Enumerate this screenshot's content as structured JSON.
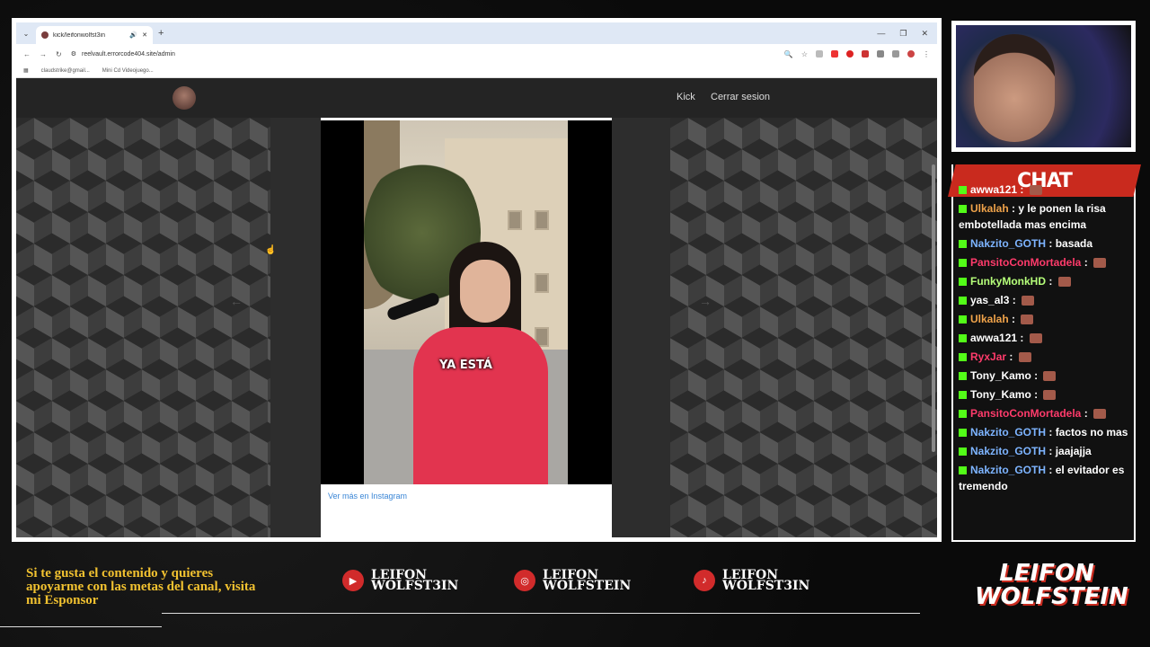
{
  "browser": {
    "tab_title": "kick/leifonwolfst3in",
    "url": "reelvault.errorcode404.site/admin",
    "bookmarks": [
      "claudstrike@gmail...",
      "Mini Cd Videojuego..."
    ]
  },
  "site": {
    "nav_kick": "Kick",
    "nav_logout": "Cerrar sesion",
    "video_caption": "YA ESTÁ",
    "instagram_link": "Ver más en Instagram"
  },
  "chat": {
    "title": "CHAT",
    "messages": [
      {
        "user": "awwa121",
        "text": "",
        "color": "#ffffff"
      },
      {
        "user": "Ulkalah",
        "text": "y le ponen la risa embotellada mas encima",
        "color": "#f0a34a"
      },
      {
        "user": "Nakzito_GOTH",
        "text": "basada",
        "color": "#7db4ff"
      },
      {
        "user": "PansitoConMortadela",
        "text": "",
        "color": "#ff3b6b"
      },
      {
        "user": "FunkyMonkHD",
        "text": "",
        "color": "#b6ff7a"
      },
      {
        "user": "yas_al3",
        "text": "",
        "color": "#ffffff"
      },
      {
        "user": "Ulkalah",
        "text": "",
        "color": "#f0a34a"
      },
      {
        "user": "awwa121",
        "text": "",
        "color": "#ffffff"
      },
      {
        "user": "RyxJar",
        "text": "",
        "color": "#ff3b6b"
      },
      {
        "user": "Tony_Kamo",
        "text": "",
        "color": "#ffffff"
      },
      {
        "user": "Tony_Kamo",
        "text": "",
        "color": "#ffffff"
      },
      {
        "user": "PansitoConMortadela",
        "text": "",
        "color": "#ff3b6b"
      },
      {
        "user": "Nakzito_GOTH",
        "text": "factos no mas",
        "color": "#7db4ff"
      },
      {
        "user": "Nakzito_GOTH",
        "text": "jaajajja",
        "color": "#7db4ff"
      },
      {
        "user": "Nakzito_GOTH",
        "text": "el evitador es tremendo",
        "color": "#7db4ff"
      }
    ]
  },
  "footer": {
    "promo": "Si te gusta el contenido y quieres apoyarme con las metas del canal, visita mi Esponsor",
    "youtube": "LEIFON WOLFST3IN",
    "instagram": "LEIFON WOLFSTEIN",
    "tiktok": "LEIFON WOLFST3IN",
    "brand_line1": "LEIFON",
    "brand_line2": "WOLFSTEIN"
  }
}
